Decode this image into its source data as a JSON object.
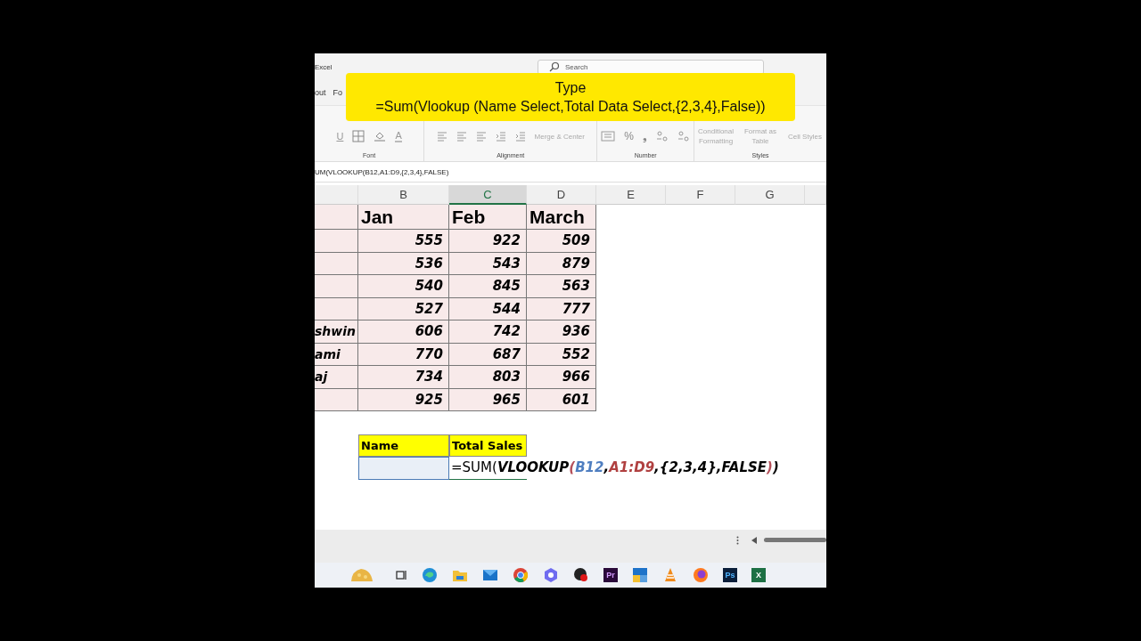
{
  "title_bar": {
    "app": "Excel",
    "search_placeholder": "Search"
  },
  "menu": [
    "out",
    "Fo"
  ],
  "overlay": {
    "lines": [
      "Type",
      "=Sum(Vlookup (Name Select,Total Data Select,{2,3,4},False))"
    ]
  },
  "ribbon": {
    "groups": [
      {
        "label": "Font",
        "tools": [
          {
            "kind": "underline",
            "label": "U"
          },
          {
            "kind": "borders"
          },
          {
            "kind": "fill"
          },
          {
            "kind": "fontcolor",
            "label": "A"
          }
        ]
      },
      {
        "label": "Alignment",
        "tools": [
          {
            "kind": "align"
          },
          {
            "kind": "align"
          },
          {
            "kind": "align"
          },
          {
            "kind": "indent"
          },
          {
            "kind": "indent"
          },
          {
            "kind": "merge",
            "label": "Merge & Center"
          }
        ]
      },
      {
        "label": "Number",
        "tools": [
          {
            "kind": "format"
          },
          {
            "kind": "text",
            "label": "%"
          },
          {
            "kind": "text",
            "label": "❟"
          },
          {
            "kind": "decimal"
          },
          {
            "kind": "decimal"
          }
        ]
      },
      {
        "label": "Styles",
        "tools": [
          {
            "kind": "style",
            "label": "Conditional Formatting"
          },
          {
            "kind": "style",
            "label": "Format as Table"
          },
          {
            "kind": "style",
            "label": "Cell Styles"
          }
        ]
      }
    ]
  },
  "formula_bar": "UM(VLOOKUP(B12,A1:D9,{2,3,4},FALSE)",
  "columns": [
    {
      "label": "B",
      "selected": false
    },
    {
      "label": "C",
      "selected": true
    },
    {
      "label": "D",
      "selected": false
    },
    {
      "label": "E",
      "selected": false
    },
    {
      "label": "F",
      "selected": false
    },
    {
      "label": "G",
      "selected": false
    }
  ],
  "table": {
    "header": [
      "Jan",
      "Feb",
      "March"
    ],
    "rows": [
      {
        "values": [
          "555",
          "922",
          "509"
        ]
      },
      {
        "values": [
          "536",
          "543",
          "879"
        ]
      },
      {
        "values": [
          "540",
          "845",
          "563"
        ]
      },
      {
        "values": [
          "527",
          "544",
          "777"
        ]
      },
      {
        "name": "shwin",
        "values": [
          "606",
          "742",
          "936"
        ]
      },
      {
        "name": "ami",
        "values": [
          "770",
          "687",
          "552"
        ]
      },
      {
        "name": "aj",
        "values": [
          "734",
          "803",
          "966"
        ]
      },
      {
        "values": [
          "925",
          "965",
          "601"
        ]
      }
    ]
  },
  "lookup": {
    "labels": [
      "Name",
      "Total Sales"
    ],
    "name_cell": {
      "selected": true
    },
    "formula": [
      {
        "text": "=SUM(",
        "kind": "plain"
      },
      {
        "text": "VLOOKUP",
        "kind": "func"
      },
      {
        "text": "(",
        "kind": "paren"
      },
      {
        "text": "B12",
        "kind": "ref1"
      },
      {
        "text": ",",
        "kind": "func"
      },
      {
        "text": "A1:D9",
        "kind": "ref2"
      },
      {
        "text": ",{2,3,4},FALSE",
        "kind": "func"
      },
      {
        "text": ")",
        "kind": "paren"
      },
      {
        "text": ")",
        "kind": "func"
      }
    ]
  },
  "taskbar": [
    {
      "kind": "widget"
    },
    {
      "kind": "taskview"
    },
    {
      "kind": "edge"
    },
    {
      "kind": "folder"
    },
    {
      "kind": "mail"
    },
    {
      "kind": "chrome"
    },
    {
      "kind": "copilot"
    },
    {
      "kind": "recorder"
    },
    {
      "kind": "premiere",
      "label": "Pr"
    },
    {
      "kind": "tiles"
    },
    {
      "kind": "cone"
    },
    {
      "kind": "firefox"
    },
    {
      "kind": "photoshop",
      "label": "Ps"
    },
    {
      "kind": "excel",
      "label": "X"
    }
  ]
}
